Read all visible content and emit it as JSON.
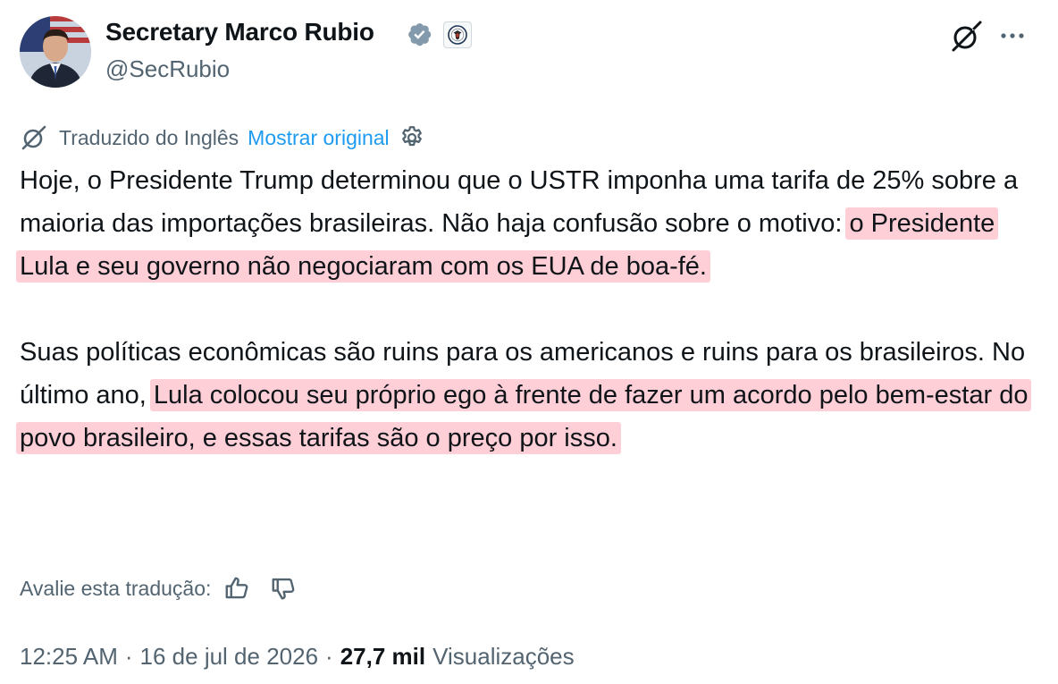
{
  "author": {
    "name": "Secretary Marco Rubio",
    "handle": "@SecRubio"
  },
  "icons": {
    "verified": "verified-badge-icon",
    "affiliation": "state-department-seal-icon",
    "grok": "grok-icon",
    "more": "more-options-icon",
    "translate": "grok-translate-icon",
    "settings": "gear-icon",
    "thumbs_up": "thumbs-up-icon",
    "thumbs_down": "thumbs-down-icon"
  },
  "colors": {
    "text": "#0f1419",
    "secondary": "#536471",
    "link": "#1d9bf0",
    "verified": "#829aab",
    "highlight": "#ff6982"
  },
  "translation": {
    "label": "Traduzido do Inglês",
    "show_original": "Mostrar original"
  },
  "post": {
    "p1_a": "Hoje, o Presidente Trump determinou que o USTR imponha uma tarifa de 25% sobre a maioria das importações brasileiras. Não haja confusão sobre o motivo:",
    "p1_hl": "o Presidente Lula e seu governo não negociaram com os EUA de boa-fé.",
    "p2_a": "Suas políticas econômicas são ruins para os americanos e ruins para os brasileiros. No último ano,",
    "p2_hl": "Lula colocou seu próprio ego à frente de fazer um acordo pelo bem-estar do povo brasileiro, e essas tarifas são o preço por isso."
  },
  "rating": {
    "label": "Avalie esta tradução:"
  },
  "meta": {
    "time": "12:25 AM",
    "separator": "·",
    "date": "16 de jul de 2026",
    "views_count": "27,7 mil",
    "views_label": "Visualizações"
  }
}
